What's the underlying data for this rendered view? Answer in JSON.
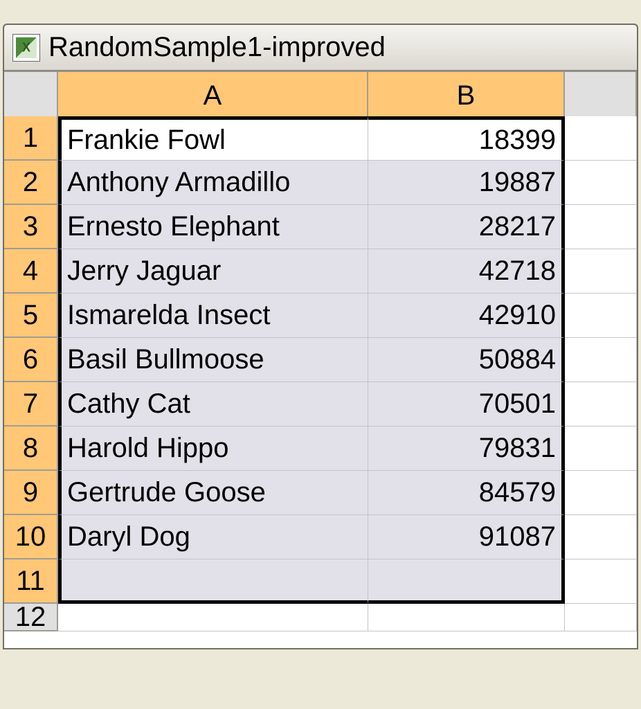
{
  "title": "RandomSample1-improved",
  "columns": [
    "A",
    "B"
  ],
  "rows": [
    {
      "n": "1",
      "a": "Frankie Fowl",
      "b": "18399"
    },
    {
      "n": "2",
      "a": "Anthony Armadillo",
      "b": "19887"
    },
    {
      "n": "3",
      "a": "Ernesto Elephant",
      "b": "28217"
    },
    {
      "n": "4",
      "a": "Jerry Jaguar",
      "b": "42718"
    },
    {
      "n": "5",
      "a": "Ismarelda Insect",
      "b": "42910"
    },
    {
      "n": "6",
      "a": "Basil Bullmoose",
      "b": "50884"
    },
    {
      "n": "7",
      "a": "Cathy Cat",
      "b": "70501"
    },
    {
      "n": "8",
      "a": "Harold Hippo",
      "b": "79831"
    },
    {
      "n": "9",
      "a": "Gertrude Goose",
      "b": "84579"
    },
    {
      "n": "10",
      "a": "Daryl Dog",
      "b": "91087"
    },
    {
      "n": "11",
      "a": "",
      "b": ""
    }
  ],
  "extraRow": "12"
}
